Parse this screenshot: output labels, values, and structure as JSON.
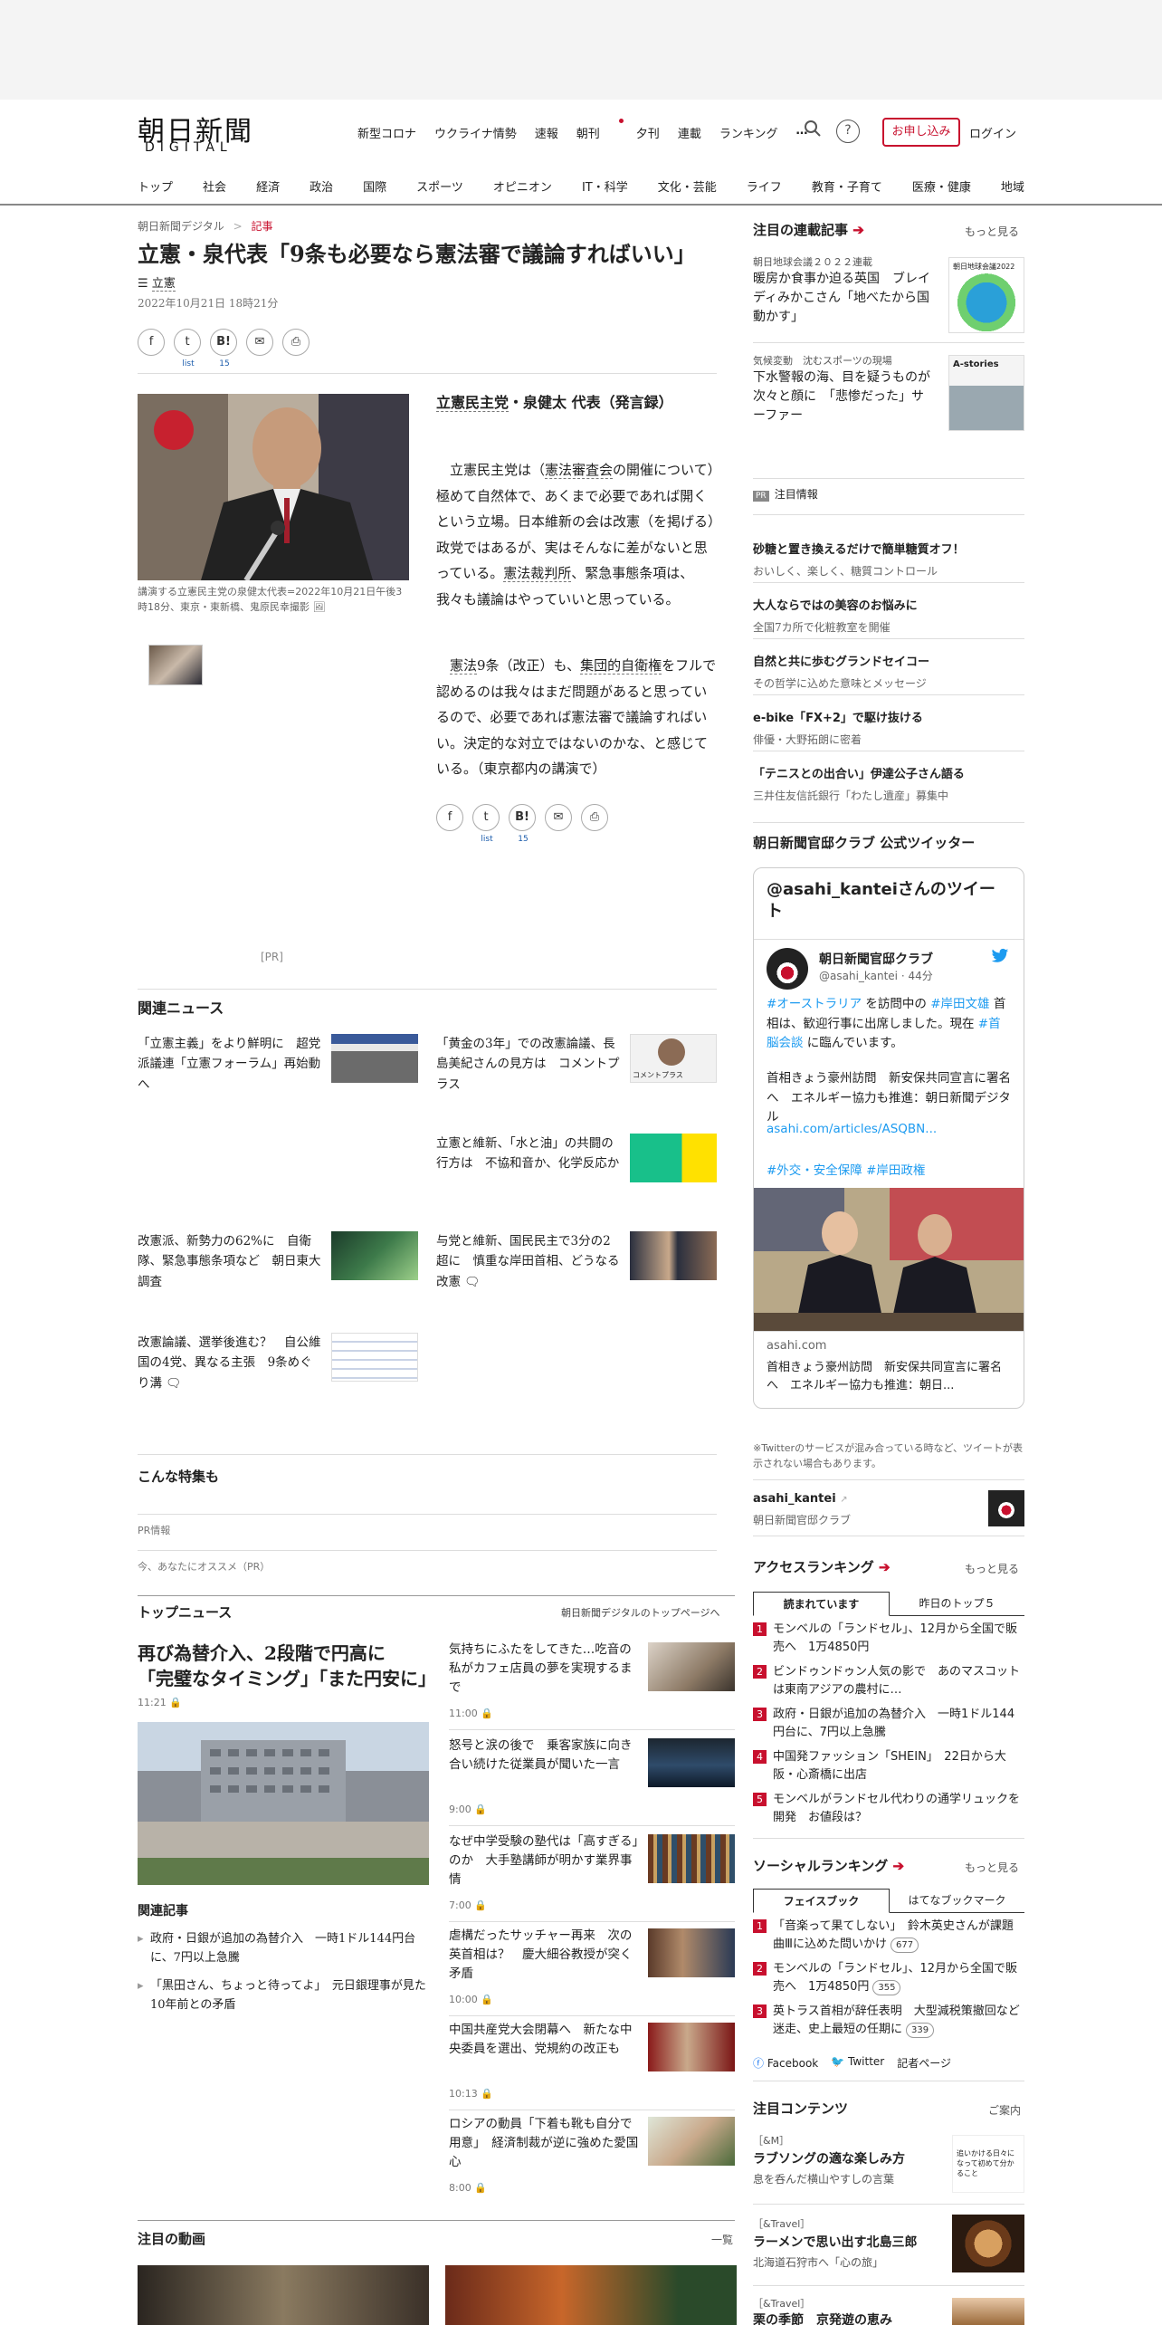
{
  "header": {
    "logo_jp": "朝日新聞",
    "logo_en": "DIGITAL",
    "nav": [
      "新型コロナ",
      "ウクライナ情勢",
      "速報",
      "朝刊",
      "夕刊",
      "連載",
      "ランキング",
      "…"
    ],
    "search_icon": "search-icon",
    "help_icon": "help-icon",
    "signup": "お申し込み",
    "login": "ログイン"
  },
  "categories": [
    "トップ",
    "社会",
    "経済",
    "政治",
    "国際",
    "スポーツ",
    "オピニオン",
    "IT・科学",
    "文化・芸能",
    "ライフ",
    "教育・子育て",
    "医療・健康",
    "地域"
  ],
  "breadcrumb": {
    "site": "朝日新聞デジタル",
    "sep": ">",
    "current": "記事"
  },
  "article": {
    "title": "立憲・泉代表「9条も必要なら憲法審で議論すればいい」",
    "tag": "立憲",
    "datetime": "2022年10月21日 18時21分",
    "share": {
      "fb": "f",
      "tw": "t",
      "hatena": "B!",
      "hatena_count": "15",
      "mail": "✉",
      "print": "⎙",
      "list": "list"
    },
    "photo_caption": "講演する立憲民主党の泉健太代表=2022年10月21日午後3時18分、東京・東新橋、鬼原民幸撮影",
    "heading_party": "立憲民主党",
    "heading_rest": "・泉健太 代表（発言録）",
    "p1_a": "立憲民主党は（",
    "p1_b": "憲法審査会",
    "p1_c": "の開催について）極めて自然体で、あくまで必要であれば開くという立場。日本維新の会は改憲（を掲げる）政党ではあるが、実はそんなに差がないと思っている。",
    "p1_d": "憲法裁判所",
    "p1_e": "、緊急事態条項は、我々も議論はやっていいと思っている。",
    "p2_a": "憲法",
    "p2_b": "9条（改正）も、",
    "p2_c": "集団的自衛権",
    "p2_d": "をフルで認めるのは我々はまだ問題があると思っているので、必要であれば憲法審で議論すればいい。決定的な対立ではないのかな、と感じている。（東京都内の講演で）",
    "pr": "[PR]"
  },
  "related": {
    "title": "関連ニュース",
    "items": [
      {
        "text": "「立憲主義」をより鮮明に　超党派議連「立憲フォーラム」再始動へ"
      },
      {
        "text": "「黄金の3年」での改憲論議、長島美紀さんの見方は　コメントプラス"
      },
      {
        "text": "立憲と維新、「水と油」の共闘の行方は　不協和音か、化学反応か"
      },
      {
        "text": "改憲派、新勢力の62%に　自衛隊、緊急事態条項など　朝日東大調査"
      },
      {
        "text": "与党と維新、国民民主で3分の2超に　慎重な岸田首相、どうなる改憲"
      },
      {
        "text": "改憲論議、選挙後進む？　自公維国の4党、異なる主張　9条めぐり溝"
      }
    ],
    "thumb_badge": "コメントプラス"
  },
  "features": {
    "title": "こんな特集も",
    "pr_info": "PR情報",
    "recommend": "今、あなたにオススメ（PR）"
  },
  "top_news": {
    "title": "トップニュース",
    "link": "朝日新聞デジタルのトップページへ",
    "main_title": "再び為替介入、2段階で円高に　「完璧なタイミング」「また円安に」",
    "main_time": "11:21",
    "related_title": "関連記事",
    "related": [
      "政府・日銀が追加の為替介入　一時1ドル144円台に、7円以上急騰",
      "「黒田さん、ちょっと待ってよ」　元日銀理事が見た10年前との矛盾"
    ],
    "items": [
      {
        "text": "気持ちにふたをしてきた…吃音の私がカフェ店員の夢を実現するまで",
        "time": "11:00"
      },
      {
        "text": "怒号と涙の後で　乗客家族に向き合い続けた従業員が聞いた一言",
        "time": "9:00"
      },
      {
        "text": "なぜ中学受験の塾代は「高すぎる」のか　大手塾講師が明かす業界事情",
        "time": "7:00"
      },
      {
        "text": "虐構だったサッチャー再来　次の英首相は？　慶大細谷教授が突く矛盾",
        "time": "10:00"
      },
      {
        "text": "中国共産党大会閉幕へ　新たな中央委員を選出、党規約の改正も",
        "time": "10:13"
      },
      {
        "text": "ロシアの動員「下着も靴も自分で用意」　経済制裁が逆に強めた愛国心",
        "time": "8:00"
      }
    ]
  },
  "videos": {
    "title": "注目の動画",
    "more": "一覧"
  },
  "sidebar": {
    "series": {
      "title": "注目の連載記事",
      "more": "もっと見る",
      "items": [
        {
          "text": "暖房か食事か迫る英国　ブレイディみかこさん「地べたから国動かす」",
          "thumb": "朝日地球会議2022"
        },
        {
          "label": "気候変動　沈むスポーツの現場",
          "text": "下水警報の海、目を疑うものが次々と顔に　「悲惨だった」サーファー",
          "thumb": "A-stories"
        }
      ],
      "series_label": "朝日地球会議２０２２連載"
    },
    "pr_title": "注目情報",
    "pr_badge": "PR",
    "pr_items": [
      {
        "title": "砂糖と置き換えるだけで簡単糖質オフ！",
        "sub": "おいしく、楽しく、糖質コントロール"
      },
      {
        "title": "大人ならではの美容のお悩みに",
        "sub": "全国7カ所で化粧教室を開催"
      },
      {
        "title": "自然と共に歩むグランドセイコー",
        "sub": "その哲学に込めた意味とメッセージ"
      },
      {
        "title": "e-bike「FX+2」で駆け抜ける",
        "sub": "俳優・大野拓朗に密着"
      },
      {
        "title": "「テニスとの出合い」伊達公子さん語る",
        "sub": "三井住友信託銀行「わたし遺産」募集中"
      }
    ],
    "twitter": {
      "section_title": "朝日新聞官邸クラブ 公式ツイッター",
      "box_title": "@asahi_kanteiさんのツイート",
      "name": "朝日新聞官邸クラブ",
      "handle": "@asahi_kantei · 44分",
      "tweet_line1_tag": "#オーストラリア",
      "tweet_line1_rest": " を訪問中の ",
      "tweet_tag2": "#岸田文雄",
      "tweet_mid": " 首相は、歓迎行事に出席しました。現在 ",
      "tweet_tag3": "#首脳会談",
      "tweet_end": " に臨んでいます。",
      "tweet_body": "首相きょう豪州訪問　新安保共同宣言に署名へ　エネルギー協力も推進：朝日新聞デジタル",
      "tweet_link": "asahi.com/articles/ASQBN...",
      "tweet_tags": "#外交・安全保障 #岸田政権",
      "card_domain": "asahi.com",
      "card_title": "首相きょう豪州訪問　新安保共同宣言に署名へ　エネルギー協力も推進：朝日...",
      "note": "※Twitterのサービスが混み合っている時など、ツイートが表示されない場合もあります。",
      "account_id": "asahi_kantei",
      "account_name": "朝日新聞官邸クラブ"
    },
    "access": {
      "title": "アクセスランキング",
      "more": "もっと見る",
      "tabs": [
        "読まれています",
        "昨日のトップ５"
      ],
      "items": [
        "モンベルの「ランドセル」、12月から全国で販売へ　1万4850円",
        "ビンドゥンドゥン人気の影で　あのマスコットは東南アジアの農村に…",
        "政府・日銀が追加の為替介入　一時1ドル144円台に、7円以上急騰",
        "中国発ファッション「SHEIN」　22日から大阪・心斎橋に出店",
        "モンベルがランドセル代わりの通学リュックを開発　お値段は？"
      ]
    },
    "social": {
      "title": "ソーシャルランキング",
      "more": "もっと見る",
      "tabs": [
        "フェイスブック",
        "はてなブックマーク"
      ],
      "items": [
        {
          "text": "「音楽って果てしない」　鈴木英史さんが課題曲Ⅲに込めた問いかけ",
          "count": "677"
        },
        {
          "text": "モンベルの「ランドセル」、12月から全国で販売へ　1万4850円",
          "count": "355"
        },
        {
          "text": "英トラス首相が辞任表明　大型減税策撤回など迷走、史上最短の任期に",
          "count": "339"
        }
      ],
      "links": [
        "Facebook",
        "Twitter",
        "記者ページ"
      ]
    },
    "contents": {
      "title": "注目コンテンツ",
      "more": "ご案内",
      "items": [
        {
          "label": "［&M］",
          "title": "ラブソングの適な楽しみ方",
          "sub": "息を呑んだ横山やすしの言葉",
          "thumb": "追いかける日々になって初めて分かること"
        },
        {
          "label": "［&Travel］",
          "title": "ラーメンで思い出す北島三郎",
          "sub": "北海道石狩市へ「心の旅」"
        },
        {
          "label": "［&Travel］",
          "title": "栗の季節　京発遊の恵み"
        }
      ]
    }
  },
  "colors": {
    "accent": "#c8102e",
    "link": "#1a5bab",
    "twitter": "#1d9bf0"
  }
}
